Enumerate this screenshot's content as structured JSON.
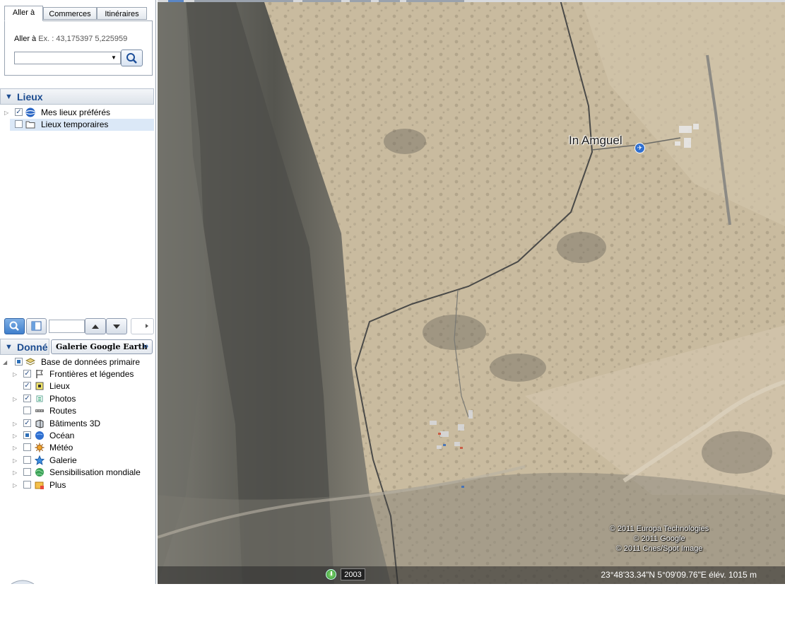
{
  "search_panel": {
    "tabs": [
      "Aller à",
      "Commerces",
      "Itinéraires"
    ],
    "goto_label": "Aller à",
    "goto_hint": "Ex. : 43,175397 5,225959",
    "goto_value": ""
  },
  "places": {
    "title": "Lieux",
    "items": [
      {
        "label": "Mes lieux préférés",
        "checked": true,
        "icon": "earth-icon"
      },
      {
        "label": "Lieux temporaires",
        "checked": false,
        "icon": "folder-icon"
      }
    ]
  },
  "layers": {
    "title": "Donné",
    "gallery_button": "Galerie Google Earth",
    "gallery_chevron": "››",
    "root": {
      "label": "Base de données primaire",
      "icon": "layers-stack-icon"
    },
    "items": [
      {
        "label": "Frontières et légendes",
        "state": "checked",
        "icon": "flag-icon"
      },
      {
        "label": "Lieux",
        "state": "checked",
        "icon": "place-marker-icon"
      },
      {
        "label": "Photos",
        "state": "checked",
        "icon": "photo-icon"
      },
      {
        "label": "Routes",
        "state": "unchecked",
        "icon": "road-icon"
      },
      {
        "label": "Bâtiments 3D",
        "state": "checked",
        "icon": "building-3d-icon"
      },
      {
        "label": "Océan",
        "state": "partial",
        "icon": "ocean-globe-icon"
      },
      {
        "label": "Météo",
        "state": "unchecked",
        "icon": "sun-icon"
      },
      {
        "label": "Galerie",
        "state": "unchecked",
        "icon": "star-icon"
      },
      {
        "label": "Sensibilisation mondiale",
        "state": "unchecked",
        "icon": "world-icon"
      },
      {
        "label": "Plus",
        "state": "unchecked",
        "icon": "more-folder-icon"
      }
    ]
  },
  "map": {
    "place_label": "In Amguel",
    "copyright": [
      "© 2011 Europa Technologies",
      "© 2011 Google",
      "© 2011 Cnes/Spot Image"
    ],
    "year": "2003",
    "status": "23°48'33.34\"N   5°09'09.76\"E  élév.  1015 m",
    "colors": {
      "terrain": "#c8b99d",
      "ridge": "#5a5a56",
      "road": "#4a4a48"
    }
  }
}
